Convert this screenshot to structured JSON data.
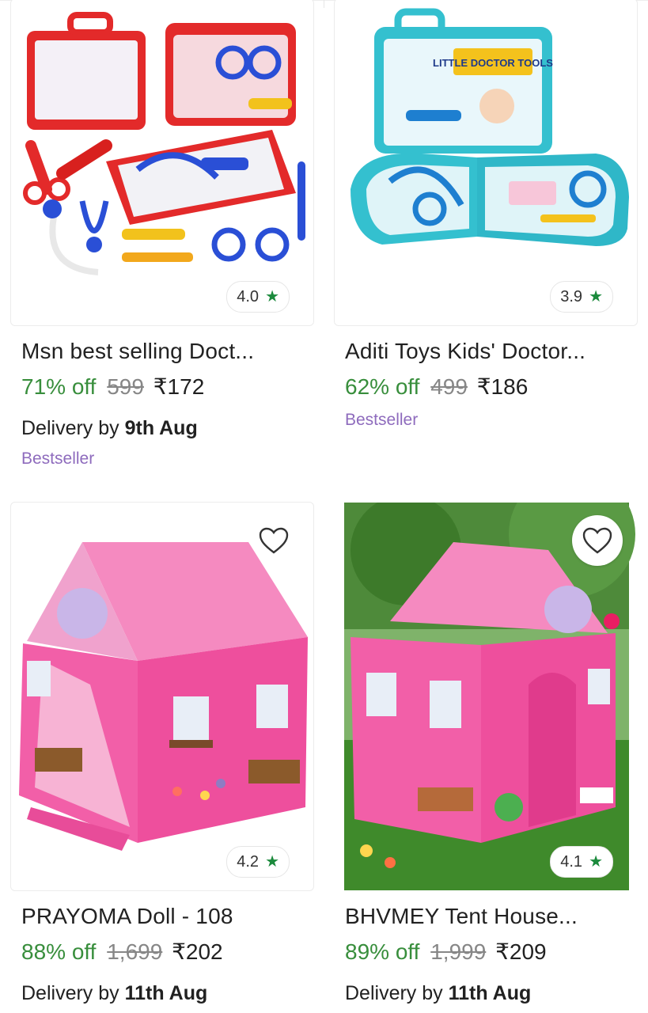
{
  "products": [
    {
      "title": "Msn best selling Doct...",
      "rating": "4.0",
      "discount": "71% off",
      "mrp": "599",
      "price": "₹172",
      "delivery_prefix": "Delivery by",
      "delivery_date": "9th Aug",
      "badge": "Bestseller",
      "image": "red doctor toy kit",
      "colors": {
        "case": "#e32a2a",
        "accent": "#2a4fd6"
      }
    },
    {
      "title": "Aditi Toys Kids' Doctor...",
      "rating": "3.9",
      "discount": "62% off",
      "mrp": "499",
      "price": "₹186",
      "badge": "Bestseller",
      "image": "teal doctor toy kit",
      "box_text": "LITTLE DOCTOR TOOLS",
      "colors": {
        "case": "#34c0cf",
        "accent": "#1e7fd0"
      }
    },
    {
      "title": "PRAYOMA Doll - 108",
      "rating": "4.2",
      "discount": "88% off",
      "mrp": "1,699",
      "price": "₹202",
      "delivery_prefix": "Delivery by",
      "delivery_date": "11th Aug",
      "image": "pink tent house",
      "colors": {
        "tent": "#f25fa8",
        "roof": "#f58ac0"
      }
    },
    {
      "title": "BHVMEY Tent House...",
      "rating": "4.1",
      "discount": "89% off",
      "mrp": "1,999",
      "price": "₹209",
      "delivery_prefix": "Delivery by",
      "delivery_date": "11th Aug",
      "image": "pink tent house on grass",
      "colors": {
        "tent": "#f05aa6",
        "grass": "#3f8a2b"
      }
    }
  ],
  "icons": {
    "rating": "star-icon",
    "wishlist": "heart-icon"
  },
  "theme": {
    "discount_green": "#388e3c",
    "mrp_gray": "#878787",
    "star_green": "#1b8a3c",
    "bestseller_purple": "#8e6bbd"
  }
}
